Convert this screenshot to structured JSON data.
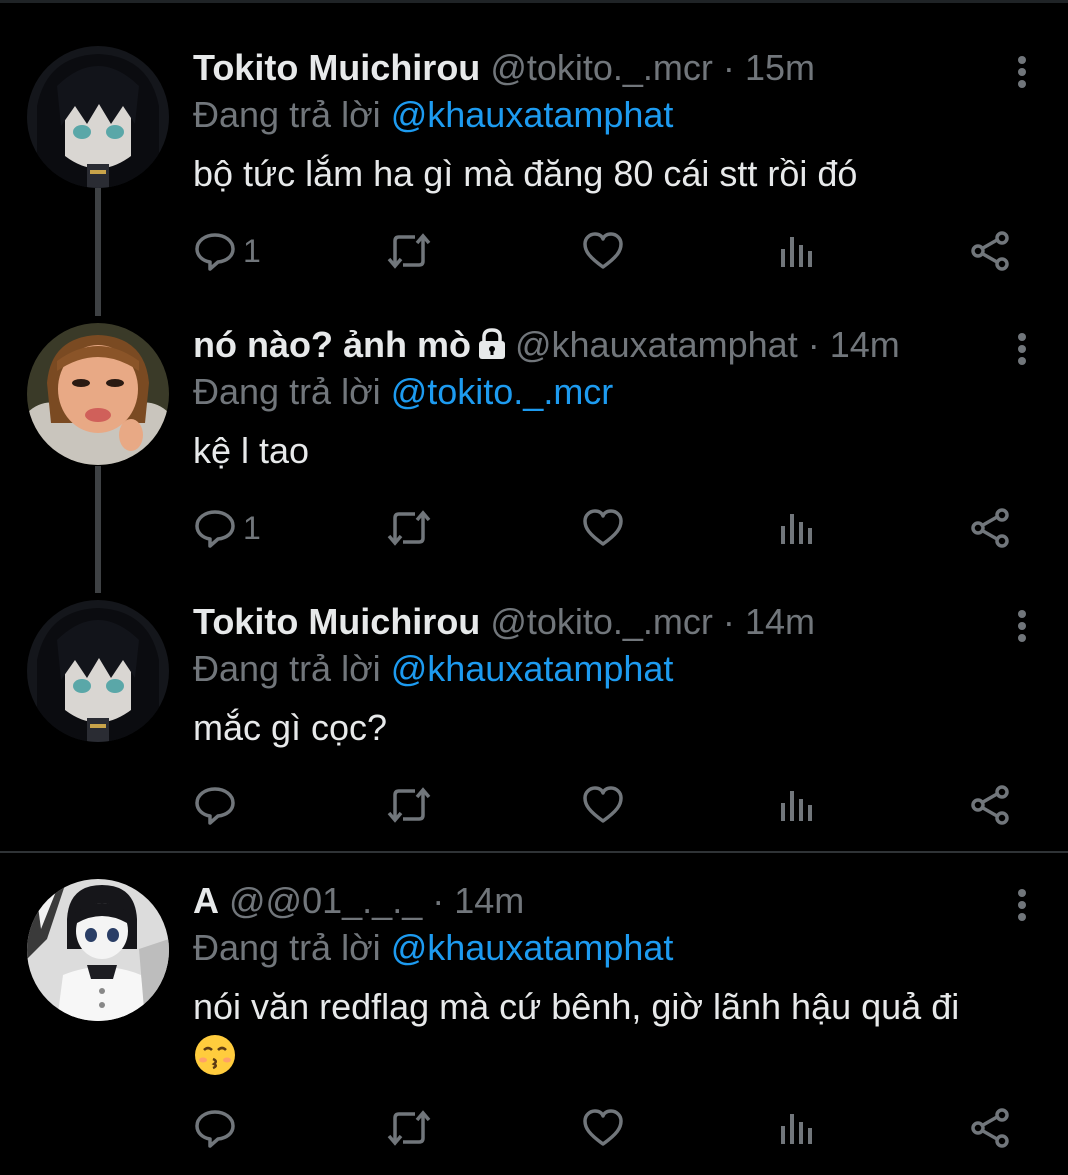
{
  "colors": {
    "background": "#000000",
    "text": "#e7e9ea",
    "muted": "#71767b",
    "mention": "#1d9bf0",
    "thread_line": "#3e4144"
  },
  "tweets": [
    {
      "name": "Tokito Muichirou",
      "handle": "@tokito._.mcr",
      "dot": "·",
      "time": "15m",
      "reply_prefix": "Đang trả lời",
      "reply_mention": "@khauxatamphat",
      "text": "bộ tức lắm ha gì mà đăng 80 cái stt rồi đó",
      "reply_count": "1",
      "avatar_icon": "anime-boy-avatar"
    },
    {
      "name": "nó nào? ảnh mò",
      "protected_icon": "lock-icon",
      "handle": "@khauxatamphat",
      "dot": "·",
      "time": "14m",
      "reply_prefix": "Đang trả lời",
      "reply_mention": "@tokito._.mcr",
      "text": "kệ l tao",
      "reply_count": "1",
      "avatar_icon": "doll-avatar"
    },
    {
      "name": "Tokito Muichirou",
      "handle": "@tokito._.mcr",
      "dot": "·",
      "time": "14m",
      "reply_prefix": "Đang trả lời",
      "reply_mention": "@khauxatamphat",
      "text": "mắc gì cọc?",
      "reply_count": "",
      "avatar_icon": "anime-boy-avatar"
    },
    {
      "name": "A",
      "handle": "@@01_._._",
      "dot": "·",
      "time": "14m",
      "reply_prefix": "Đang trả lời",
      "reply_mention": "@khauxatamphat",
      "text": "nói văn redflag mà cứ bênh, giờ lãnh hậu quả đi",
      "emoji": "kissing-face-emoji",
      "reply_count": "",
      "avatar_icon": "manga-avatar"
    }
  ],
  "action_icons": [
    "reply-icon",
    "retweet-icon",
    "like-icon",
    "views-icon",
    "share-icon"
  ]
}
